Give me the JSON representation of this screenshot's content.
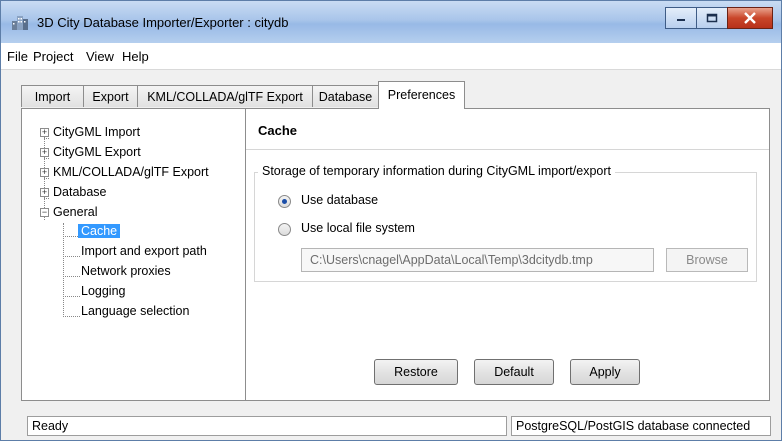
{
  "window": {
    "title": "3D City Database Importer/Exporter : citydb"
  },
  "menu": [
    "File",
    "Project",
    "View",
    "Help"
  ],
  "tabs": [
    {
      "label": "Import"
    },
    {
      "label": "Export"
    },
    {
      "label": "KML/COLLADA/glTF Export"
    },
    {
      "label": "Database"
    },
    {
      "label": "Preferences",
      "active": true
    }
  ],
  "tree": {
    "items": [
      {
        "label": "CityGML Import",
        "expander": "+"
      },
      {
        "label": "CityGML Export",
        "expander": "+"
      },
      {
        "label": "KML/COLLADA/glTF Export",
        "expander": "+"
      },
      {
        "label": "Database",
        "expander": "+"
      },
      {
        "label": "General",
        "expander": "−"
      },
      {
        "label": "Cache",
        "selected": true
      },
      {
        "label": "Import and export path"
      },
      {
        "label": "Network proxies"
      },
      {
        "label": "Logging"
      },
      {
        "label": "Language selection"
      }
    ]
  },
  "content": {
    "title": "Cache",
    "group_title": "Storage of temporary information during CityGML import/export",
    "options": [
      {
        "label": "Use database",
        "selected": true
      },
      {
        "label": "Use local file system",
        "selected": false
      }
    ],
    "path_value": "C:\\Users\\cnagel\\AppData\\Local\\Temp\\3dcitydb.tmp",
    "browse_label": "Browse",
    "buttons": {
      "restore": "Restore",
      "default": "Default",
      "apply": "Apply"
    }
  },
  "status": {
    "left": "Ready",
    "right": "PostgreSQL/PostGIS database connected"
  },
  "colors": {
    "selection": "#3399ff",
    "titlebar": "#a9c5ea",
    "close_button": "#c9462a"
  }
}
